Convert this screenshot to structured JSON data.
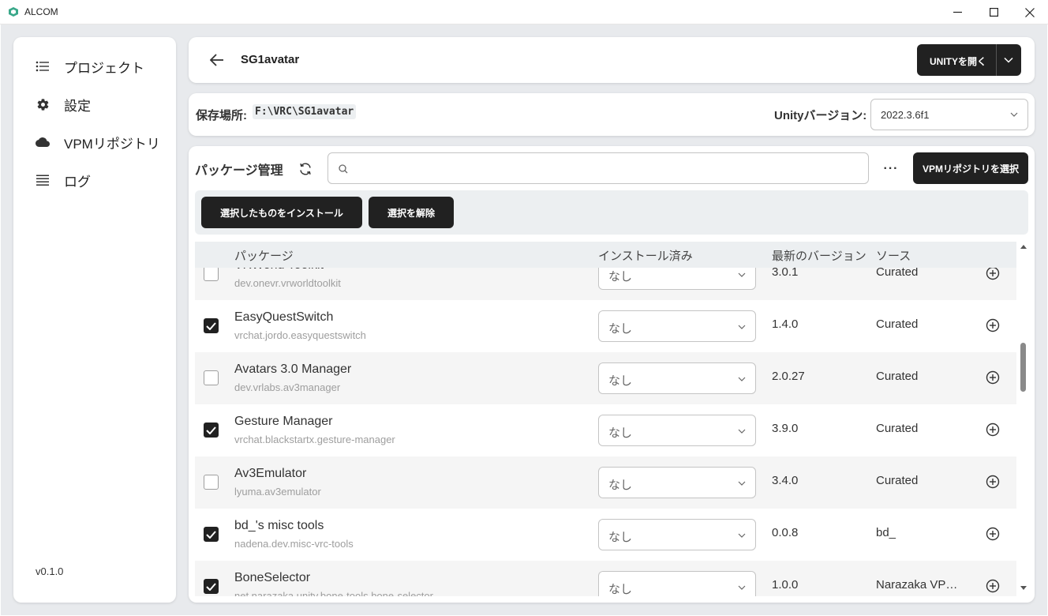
{
  "window": {
    "title": "ALCOM"
  },
  "sidebar": {
    "items": [
      {
        "label": "プロジェクト",
        "icon": "list-icon"
      },
      {
        "label": "設定",
        "icon": "gear-icon"
      },
      {
        "label": "VPMリポジトリ",
        "icon": "cloud-icon"
      },
      {
        "label": "ログ",
        "icon": "lines-icon"
      }
    ],
    "version": "v0.1.0"
  },
  "header": {
    "project_name": "SG1avatar",
    "open_unity_label": "UNITYを開く"
  },
  "location": {
    "label": "保存場所:",
    "path": "F:\\VRC\\SG1avatar",
    "unity_version_label": "Unityバージョン:",
    "unity_version": "2022.3.6f1"
  },
  "packages": {
    "title": "パッケージ管理",
    "search_placeholder": "",
    "more_label": "···",
    "select_repo_label": "VPMリポジトリを選択",
    "install_selected_label": "選択したものをインストール",
    "deselect_label": "選択を解除",
    "columns": {
      "package": "パッケージ",
      "installed": "インストール済み",
      "latest": "最新のバージョン",
      "source": "ソース"
    },
    "rows": [
      {
        "name": "VRWorld Toolkit",
        "id": "dev.onevr.vrworldtoolkit",
        "checked": false,
        "installed": "なし",
        "latest": "3.0.1",
        "source": "Curated"
      },
      {
        "name": "EasyQuestSwitch",
        "id": "vrchat.jordo.easyquestswitch",
        "checked": true,
        "installed": "なし",
        "latest": "1.4.0",
        "source": "Curated"
      },
      {
        "name": "Avatars 3.0 Manager",
        "id": "dev.vrlabs.av3manager",
        "checked": false,
        "installed": "なし",
        "latest": "2.0.27",
        "source": "Curated"
      },
      {
        "name": "Gesture Manager",
        "id": "vrchat.blackstartx.gesture-manager",
        "checked": true,
        "installed": "なし",
        "latest": "3.9.0",
        "source": "Curated"
      },
      {
        "name": "Av3Emulator",
        "id": "lyuma.av3emulator",
        "checked": false,
        "installed": "なし",
        "latest": "3.4.0",
        "source": "Curated"
      },
      {
        "name": "bd_'s misc tools",
        "id": "nadena.dev.misc-vrc-tools",
        "checked": true,
        "installed": "なし",
        "latest": "0.0.8",
        "source": "bd_"
      },
      {
        "name": "BoneSelector",
        "id": "net.narazaka.unity.bone-tools.bone-selector",
        "checked": true,
        "installed": "なし",
        "latest": "1.0.0",
        "source": "Narazaka VPM Listing"
      }
    ]
  }
}
